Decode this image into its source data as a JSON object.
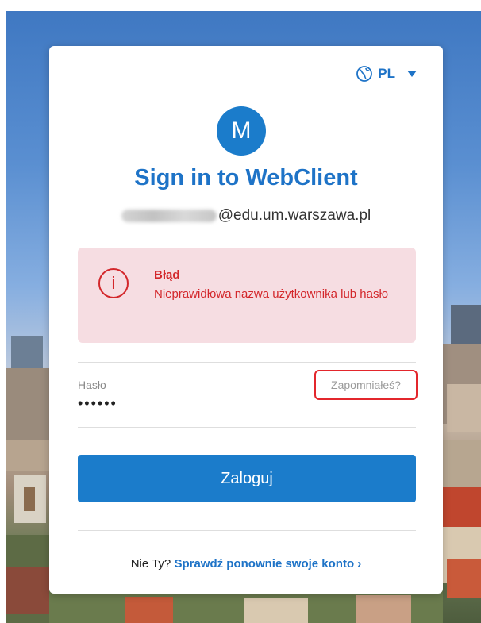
{
  "language": {
    "code": "PL",
    "icon": "globe-icon",
    "dropdown_icon": "caret-down-icon"
  },
  "avatar": {
    "letter": "M"
  },
  "title": "Sign in to WebClient",
  "account": {
    "email_domain": "@edu.um.warszawa.pl"
  },
  "error": {
    "icon": "info-circle-icon",
    "title": "Błąd",
    "message": "Nieprawidłowa nazwa użytkownika lub hasło"
  },
  "password": {
    "label": "Hasło",
    "value": "••••••",
    "forgot_label": "Zapomniałeś?"
  },
  "login_button": {
    "label": "Zaloguj"
  },
  "footer": {
    "prompt": "Nie Ty?",
    "link": "Sprawdź ponownie swoje konto ›"
  },
  "colors": {
    "primary": "#1b7ccb",
    "link": "#1e73c7",
    "error": "#d3272b",
    "error_bg": "#f6dde2"
  }
}
